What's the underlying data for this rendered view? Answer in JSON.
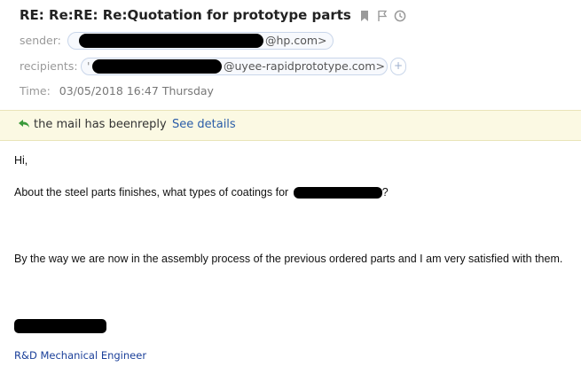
{
  "email": {
    "subject": "RE: Re:RE: Re:Quotation for prototype parts",
    "sender_label": "sender:",
    "sender_domain": "@hp.com>",
    "recipients_label": "recipients:",
    "recipients_prefix": "'",
    "recipients_domain": "@uyee-rapidprototype.com>",
    "add_recipient_label": "+",
    "time_label": "Time:",
    "time_value": "03/05/2018 16:47 Thursday"
  },
  "notice": {
    "text": "the mail has beenreply",
    "link": "See details"
  },
  "message": {
    "greeting": "Hi,",
    "line1_start": "About the steel parts finishes, what types of coatings for",
    "line1_end": "?",
    "line2": "By the way we are now in the assembly process of the previous ordered parts and I am very satisfied with them.",
    "signature_title": "R&D Mechanical Engineer"
  },
  "icons": [
    "bookmark-icon",
    "flag-icon",
    "clock-icon",
    "reply-arrow-icon"
  ],
  "colors": {
    "link": "#2a5da8",
    "notice_bg": "#fbf9e3",
    "reply_arrow": "#3a9a3a",
    "signature": "#1a3f99",
    "redaction": "#000000"
  }
}
